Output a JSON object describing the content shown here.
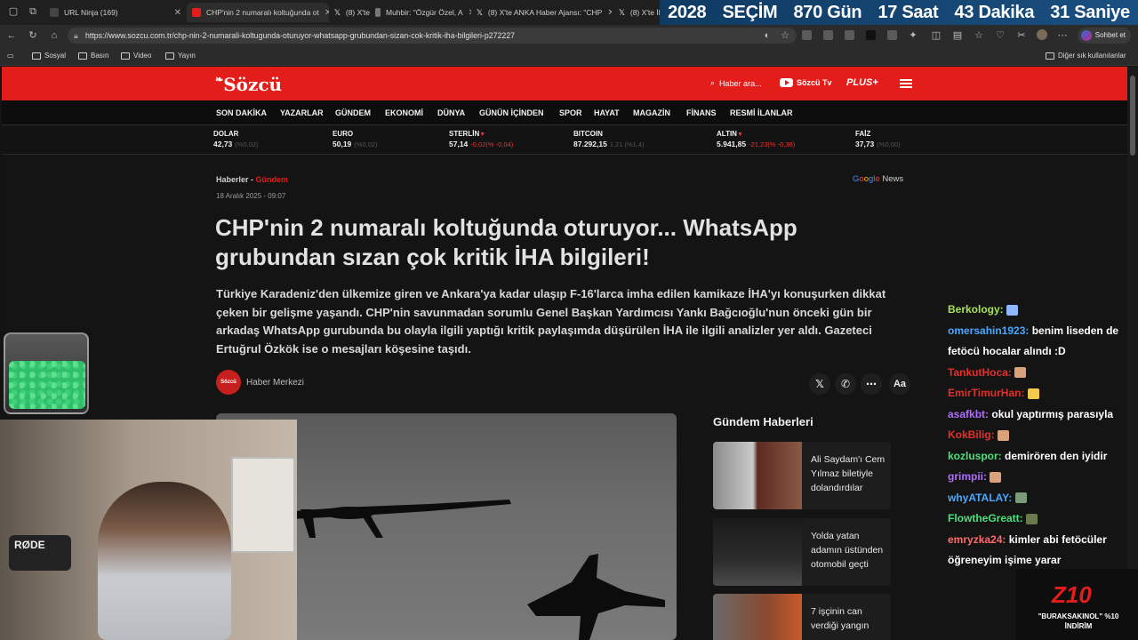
{
  "browser": {
    "tabs": [
      {
        "label": "URL Ninja (169)",
        "icon": "url-ninja-icon",
        "active": false
      },
      {
        "label": "CHP'nin 2 numaralı koltuğunda ot",
        "icon": "sozcu-favicon",
        "active": true
      },
      {
        "label": "(8) X'te",
        "icon": "x-icon",
        "active": false
      },
      {
        "label": "Muhbir: \"Özgür Özel, A",
        "icon": "muhbir-icon",
        "active": false
      },
      {
        "label": "(8) X'te ANKA Haber Ajansı: \"CHP",
        "icon": "x-icon",
        "active": false
      },
      {
        "label": "(8) X'te İl",
        "icon": "x-icon",
        "active": false
      }
    ],
    "url": "https://www.sozcu.com.tr/chp-nin-2-numarali-koltugunda-oturuyor-whatsapp-grubundan-sizan-cok-kritik-iha-bilgileri-p272227",
    "chat_button": "Sohbet et",
    "bookmarks": [
      "Sosyal",
      "Basın",
      "Video",
      "Yayın"
    ],
    "other_bookmarks": "Diğer sık kullanılanlar"
  },
  "countdown": {
    "parts": [
      "2028",
      "SEÇİM",
      "870 Gün",
      "17 Saat",
      "43 Dakika",
      "31 Saniye"
    ]
  },
  "site": {
    "logo": "Sözcü",
    "search_label": "Haber ara...",
    "tv_label": "Sözcü Tv",
    "plus_label": "PLUS+",
    "nav": [
      "SON DAKİKA",
      "YAZARLAR",
      "GÜNDEM",
      "EKONOMİ",
      "DÜNYA",
      "GÜNÜN İÇİNDEN",
      "SPOR",
      "HAYAT",
      "MAGAZİN",
      "FİNANS",
      "RESMİ İLANLAR"
    ],
    "ticker": [
      {
        "name": "DOLAR",
        "value": "42,73",
        "change": "(%0,02)",
        "trend": "flat"
      },
      {
        "name": "EURO",
        "value": "50,19",
        "change": "(%0,02)",
        "trend": "flat"
      },
      {
        "name": "STERLİN",
        "value": "57,14",
        "change": "-0,02(% -0,04)",
        "trend": "down"
      },
      {
        "name": "BITCOIN",
        "value": "87.292,15",
        "change": "1,21 (%1,4)",
        "trend": "flat"
      },
      {
        "name": "ALTIN",
        "value": "5.941,85",
        "change": "-21,23(% -0,36)",
        "trend": "down"
      },
      {
        "name": "FAİZ",
        "value": "37,73",
        "change": "(%0,00)",
        "trend": "flat"
      }
    ]
  },
  "article": {
    "breadcrumb_home": "Haberler",
    "breadcrumb_sep": " - ",
    "breadcrumb_section": "Gündem",
    "date": "18 Aralık 2025 - 09:07",
    "google_news": "News",
    "title": "CHP'nin 2 numaralı koltuğunda oturuyor... WhatsApp grubundan sızan çok kritik İHA bilgileri!",
    "summary": "Türkiye Karadeniz'den ülkemize giren ve Ankara'ya kadar ulaşıp F-16'larca imha edilen kamikaze İHA'yı konuşurken dikkat çeken bir gelişme yaşandı. CHP'nin savunmadan sorumlu Genel Başkan Yardımcısı Yankı Bağcıoğlu'nun önceki gün bir arkadaş WhatsApp gurubunda bu olayla ilgili yaptığı kritik paylaşımda düşürülen İHA ile ilgili analizler yer aldı. Gazeteci Ertuğrul Özkök ise o mesajları köşesine taşıdı.",
    "author": "Haber Merkezi",
    "author_avatar_text": "Sözcü",
    "share_icons": [
      "x-share-icon",
      "whatsapp-share-icon",
      "more-icon",
      "font-size-icon"
    ]
  },
  "sidebar": {
    "title": "Gündem Haberleri",
    "items": [
      {
        "title": "Ali Saydam'ı Cem Yılmaz biletiyle dolandırdılar"
      },
      {
        "title": "Yolda yatan adamın üstünden otomobil geçti"
      },
      {
        "title": "7 işçinin can verdiği yangın"
      }
    ]
  },
  "stream": {
    "mic_label": "RØDE",
    "chat": [
      {
        "user": "Berkology:",
        "color": "#a8e05a",
        "msg": "",
        "emote": "sparkle-emote"
      },
      {
        "user": "omersahin1923:",
        "color": "#4aa8ff",
        "msg": "benim liseden de fetöcü hocalar alındı :D",
        "emote": ""
      },
      {
        "user": "TankutHoca:",
        "color": "#e0302a",
        "msg": "",
        "emote": "face-emote"
      },
      {
        "user": "EmirTimurHan:",
        "color": "#e0302a",
        "msg": "",
        "emote": "clap-emote"
      },
      {
        "user": "asafkbt:",
        "color": "#b06bff",
        "msg": "okul yaptırmış parasıyla",
        "emote": ""
      },
      {
        "user": "KokBilig:",
        "color": "#e0302a",
        "msg": "",
        "emote": "face-emote"
      },
      {
        "user": "kozluspor:",
        "color": "#4de07a",
        "msg": "demirören den iyidir",
        "emote": ""
      },
      {
        "user": "grimpii:",
        "color": "#b06bff",
        "msg": "",
        "emote": "face-emote"
      },
      {
        "user": "whyATALAY:",
        "color": "#4aa8ff",
        "msg": "",
        "emote": "car-emote"
      },
      {
        "user": "FlowtheGreatt:",
        "color": "#4de07a",
        "msg": "",
        "emote": "tank-emote"
      },
      {
        "user": "emryzka24:",
        "color": "#ff6a6a",
        "msg": "kimler abi fetöcüler öğreneyim işime yarar",
        "emote": ""
      }
    ],
    "promo_logo_a": "Z",
    "promo_logo_b": "10",
    "promo_code": "\"BURAKSAKINOL\" %10 İNDİRİM"
  },
  "colors": {
    "brand_red": "#e31d1a",
    "countdown_blue": "#13467a"
  }
}
